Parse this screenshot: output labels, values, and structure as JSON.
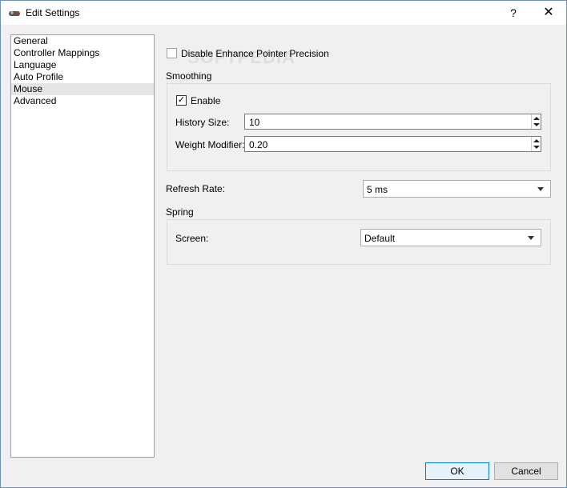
{
  "window": {
    "title": "Edit Settings",
    "help_label": "?",
    "close_label": "✕",
    "icon": "gamepad-icon"
  },
  "nav": {
    "items": [
      {
        "label": "General",
        "selected": false
      },
      {
        "label": "Controller Mappings",
        "selected": false
      },
      {
        "label": "Language",
        "selected": false
      },
      {
        "label": "Auto Profile",
        "selected": false
      },
      {
        "label": "Mouse",
        "selected": true
      },
      {
        "label": "Advanced",
        "selected": false
      }
    ]
  },
  "mouse": {
    "disable_precision": {
      "label": "Disable Enhance Pointer Precision",
      "checked": false
    },
    "watermark": "SOFTPEDIA",
    "smoothing": {
      "title": "Smoothing",
      "enable": {
        "label": "Enable",
        "checked": true,
        "mark": "✓"
      },
      "history_size": {
        "label": "History Size:",
        "value": "10"
      },
      "weight_modifier": {
        "label": "Weight Modifier:",
        "value": "0.20"
      }
    },
    "refresh_rate": {
      "label": "Refresh Rate:",
      "value": "5 ms"
    },
    "spring": {
      "title": "Spring",
      "screen": {
        "label": "Screen:",
        "value": "Default"
      }
    }
  },
  "buttons": {
    "ok": "OK",
    "cancel": "Cancel"
  },
  "colors": {
    "accent": "#0078d7",
    "selected_bg": "#e5e5e5"
  }
}
